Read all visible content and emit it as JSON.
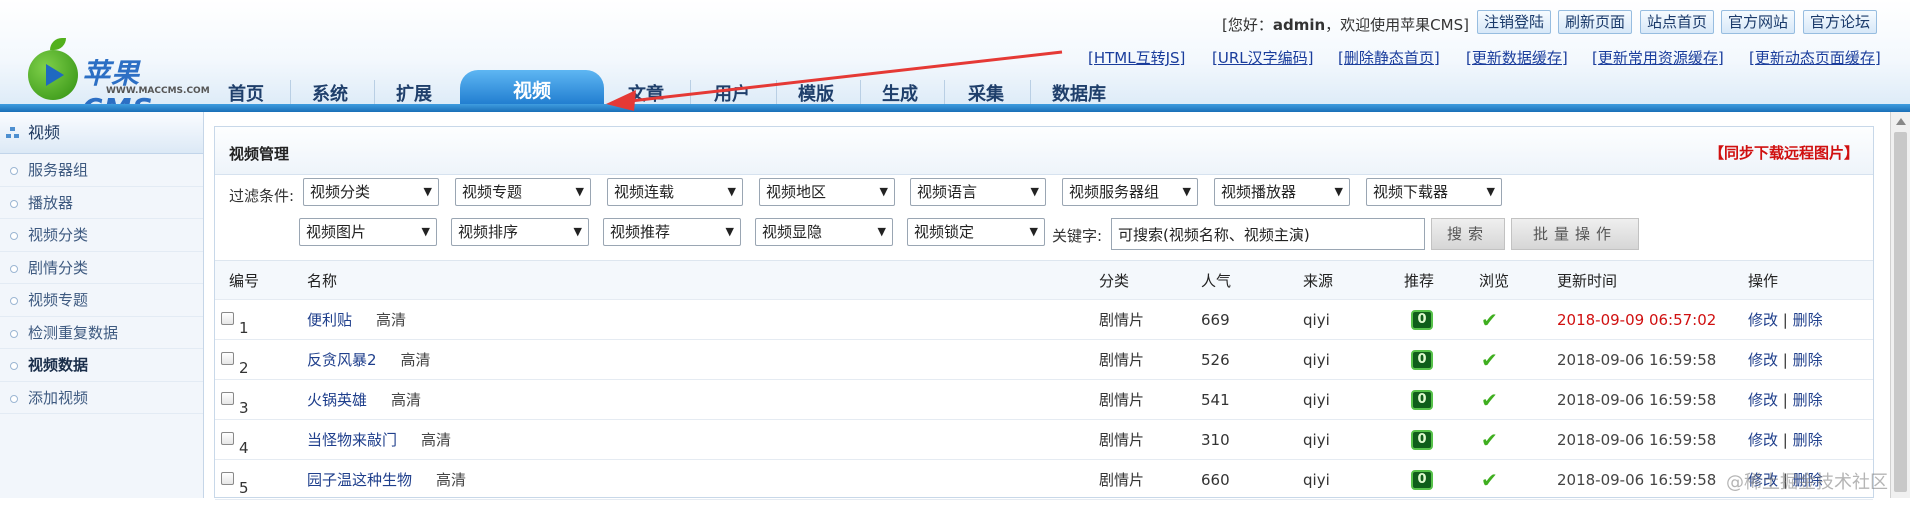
{
  "header": {
    "logo_brand": "苹果CMS",
    "logo_site": "WWW.MACCMS.COM",
    "greeting_prefix": "[您好：",
    "username": "admin",
    "greeting_suffix": "，欢迎使用苹果CMS]",
    "top_buttons": [
      "注销登陆",
      "刷新页面",
      "站点首页",
      "官方网站",
      "官方论坛"
    ],
    "quick_links": [
      "[HTML互转JS]",
      "[URL汉字编码]",
      "[删除静态首页]",
      "[更新数据缓存]",
      "[更新常用资源缓存]",
      "[更新动态页面缓存]"
    ],
    "nav": [
      "首页",
      "系统",
      "扩展",
      "视频",
      "文章",
      "用户",
      "模版",
      "生成",
      "采集",
      "数据库"
    ],
    "active_nav": "视频"
  },
  "sidebar": {
    "title": "视频",
    "items": [
      "服务器组",
      "播放器",
      "视频分类",
      "剧情分类",
      "视频专题",
      "检测重复数据",
      "视频数据",
      "添加视频"
    ],
    "active": "视频数据"
  },
  "panel": {
    "title": "视频管理",
    "sync_link": "【同步下载远程图片】",
    "filter_label": "过滤条件:",
    "filters_row1": [
      "视频分类",
      "视频专题",
      "视频连载",
      "视频地区",
      "视频语言",
      "视频服务器组",
      "视频播放器",
      "视频下载器"
    ],
    "filters_row2": [
      "视频图片",
      "视频排序",
      "视频推荐",
      "视频显隐",
      "视频锁定"
    ],
    "keyword_label": "关键字:",
    "keyword_value": "可搜索(视频名称、视频主演)",
    "search_button": "搜索",
    "batch_button": "批量操作"
  },
  "table": {
    "headers": [
      "编号",
      "名称",
      "分类",
      "人气",
      "来源",
      "推荐",
      "浏览",
      "更新时间",
      "操作"
    ],
    "rows": [
      {
        "id": "1",
        "name": "便利贴",
        "quality": "高清",
        "category": "剧情片",
        "views": "669",
        "source": "qiyi",
        "recommend": "0",
        "time": "2018-09-09 06:57:02",
        "time_color": "#d01010",
        "edit": "修改",
        "sep": "|",
        "delete": "删除"
      },
      {
        "id": "2",
        "name": "反贪风暴2",
        "quality": "高清",
        "category": "剧情片",
        "views": "526",
        "source": "qiyi",
        "recommend": "0",
        "time": "2018-09-06 16:59:58",
        "time_color": "#444444",
        "edit": "修改",
        "sep": "|",
        "delete": "删除"
      },
      {
        "id": "3",
        "name": "火锅英雄",
        "quality": "高清",
        "category": "剧情片",
        "views": "541",
        "source": "qiyi",
        "recommend": "0",
        "time": "2018-09-06 16:59:58",
        "time_color": "#444444",
        "edit": "修改",
        "sep": "|",
        "delete": "删除"
      },
      {
        "id": "4",
        "name": "当怪物来敲门",
        "quality": "高清",
        "category": "剧情片",
        "views": "310",
        "source": "qiyi",
        "recommend": "0",
        "time": "2018-09-06 16:59:58",
        "time_color": "#444444",
        "edit": "修改",
        "sep": "|",
        "delete": "删除"
      },
      {
        "id": "5",
        "name": "园子温这种生物",
        "quality": "高清",
        "category": "剧情片",
        "views": "660",
        "source": "qiyi",
        "recommend": "0",
        "time": "2018-09-06 16:59:58",
        "time_color": "#444444",
        "edit": "修改",
        "sep": "|",
        "delete": "删除"
      }
    ]
  },
  "watermark": "@稀土掘金技术社区",
  "colors": {
    "accent": "#1b78cc",
    "link": "#1f3f8c",
    "warn": "#d01010",
    "check": "#3fae1f"
  }
}
